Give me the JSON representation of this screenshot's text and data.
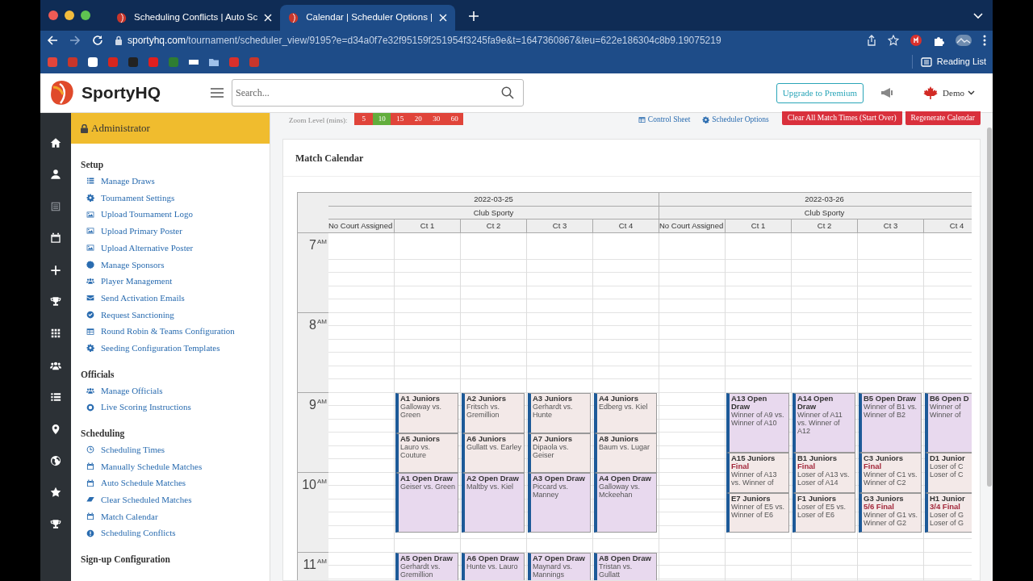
{
  "browser": {
    "tabs": [
      {
        "title": "Scheduling Conflicts | Auto Sc",
        "selected": false
      },
      {
        "title": "Calendar | Scheduler Options |",
        "selected": true
      }
    ],
    "url_domain": "sportyhq.com",
    "url_path": "/tournament/scheduler_view/9195?e=d34a0f7e32f95159f251954f3245fa9e&t=1647360867&teu=622e186304c8b9.19075219",
    "reading_list": "Reading List"
  },
  "header": {
    "brand": "SportyHQ",
    "search_placeholder": "Search...",
    "upgrade_button": "Upgrade to Premium",
    "user": "Demo"
  },
  "sidebar": {
    "role": "Administrator",
    "sections": [
      {
        "title": "Setup",
        "items": [
          "Manage Draws",
          "Tournament Settings",
          "Upload Tournament Logo",
          "Upload Primary Poster",
          "Upload Alternative Poster",
          "Manage Sponsors",
          "Player Management",
          "Send Activation Emails",
          "Request Sanctioning",
          "Round Robin & Teams Configuration",
          "Seeding Configuration Templates"
        ]
      },
      {
        "title": "Officials",
        "items": [
          "Manage Officials",
          "Live Scoring Instructions"
        ]
      },
      {
        "title": "Scheduling",
        "items": [
          "Scheduling Times",
          "Manually Schedule Matches",
          "Auto Schedule Matches",
          "Clear Scheduled Matches",
          "Match Calendar",
          "Scheduling Conflicts"
        ]
      },
      {
        "title": "Sign-up Configuration"
      }
    ]
  },
  "toolbar": {
    "zoom_label": "Zoom Level (mins):",
    "zoom_levels": [
      {
        "label": "5",
        "selected": false
      },
      {
        "label": "10",
        "selected": true
      },
      {
        "label": "15",
        "selected": false
      },
      {
        "label": "20",
        "selected": false
      },
      {
        "label": "30",
        "selected": false
      },
      {
        "label": "60",
        "selected": false
      }
    ],
    "links": [
      "Control Sheet",
      "Scheduler Options"
    ],
    "buttons": [
      "Clear All Match Times (Start Over)",
      "Regenerate Calendar"
    ]
  },
  "calendar": {
    "title": "Match Calendar",
    "hours": [
      {
        "hour": "7",
        "period": "AM"
      },
      {
        "hour": "8",
        "period": "AM"
      },
      {
        "hour": "9",
        "period": "AM"
      },
      {
        "hour": "10",
        "period": "AM"
      },
      {
        "hour": "11",
        "period": "AM"
      }
    ],
    "days": [
      {
        "date": "2022-03-25",
        "venue": "Club Sporty",
        "columns": [
          {
            "name": "No Court Assigned"
          },
          {
            "name": "Ct 1",
            "blocks": [
              [
                {
                  "kind": "juniors",
                  "title": "A1 Juniors",
                  "lines": [
                    "Galloway vs.",
                    "Green"
                  ]
                },
                {
                  "kind": "juniors",
                  "title": "A5 Juniors",
                  "lines": [
                    "Lauro vs.",
                    "Couture"
                  ]
                },
                {
                  "kind": "open",
                  "title": "A1 Open Draw",
                  "lines": [
                    "Geiser vs. Green"
                  ]
                }
              ],
              [
                {
                  "kind": "open",
                  "title": "A5 Open Draw",
                  "lines": [
                    "Gerhardt vs.",
                    "Gremillion"
                  ]
                }
              ]
            ]
          },
          {
            "name": "Ct 2",
            "blocks": [
              [
                {
                  "kind": "juniors",
                  "title": "A2 Juniors",
                  "lines": [
                    "Fritsch vs.",
                    "Gremillion"
                  ]
                },
                {
                  "kind": "juniors",
                  "title": "A6 Juniors",
                  "lines": [
                    "Gullatt vs. Earley"
                  ]
                },
                {
                  "kind": "open",
                  "title": "A2 Open Draw",
                  "lines": [
                    "Maltby vs. Kiel"
                  ]
                }
              ],
              [
                {
                  "kind": "open",
                  "title": "A6 Open Draw",
                  "lines": [
                    "Hunte vs. Lauro"
                  ]
                }
              ]
            ]
          },
          {
            "name": "Ct 3",
            "blocks": [
              [
                {
                  "kind": "juniors",
                  "title": "A3 Juniors",
                  "lines": [
                    "Gerhardt vs.",
                    "Hunte"
                  ]
                },
                {
                  "kind": "juniors",
                  "title": "A7 Juniors",
                  "lines": [
                    "Dipaola vs.",
                    "Geiser"
                  ]
                },
                {
                  "kind": "open",
                  "title": "A3 Open Draw",
                  "lines": [
                    "Piccard vs.",
                    "Manney"
                  ]
                }
              ],
              [
                {
                  "kind": "open",
                  "title": "A7 Open Draw",
                  "lines": [
                    "Maynard vs.",
                    "Mannings"
                  ]
                }
              ]
            ]
          },
          {
            "name": "Ct 4",
            "blocks": [
              [
                {
                  "kind": "juniors",
                  "title": "A4 Juniors",
                  "lines": [
                    "Edberg vs. Kiel"
                  ]
                },
                {
                  "kind": "juniors",
                  "title": "A8 Juniors",
                  "lines": [
                    "Baum vs. Lugar"
                  ]
                },
                {
                  "kind": "open",
                  "title": "A4 Open Draw",
                  "lines": [
                    "Galloway vs.",
                    "Mckeehan"
                  ]
                }
              ],
              [
                {
                  "kind": "open",
                  "title": "A8 Open Draw",
                  "lines": [
                    "Tristan vs. Gullatt"
                  ]
                }
              ]
            ]
          }
        ]
      },
      {
        "date": "2022-03-26",
        "venue": "Club Sporty",
        "columns": [
          {
            "name": "No Court Assigned"
          },
          {
            "name": "Ct 1",
            "blocks": [
              [
                {
                  "kind": "open",
                  "title": "A13 Open Draw",
                  "lines": [
                    "Winner of A9 vs.",
                    "Winner of A10"
                  ]
                },
                {
                  "kind": "juniors",
                  "title": "A15 Juniors",
                  "final": "Final",
                  "lines": [
                    "Winner of A13",
                    "vs. Winner of"
                  ]
                },
                {
                  "kind": "juniors",
                  "title": "E7 Juniors",
                  "lines": [
                    "Winner of E5 vs.",
                    "Winner of E6"
                  ]
                }
              ]
            ]
          },
          {
            "name": "Ct 2",
            "blocks": [
              [
                {
                  "kind": "open",
                  "title": "A14 Open Draw",
                  "lines": [
                    "Winner of A11",
                    "vs. Winner of",
                    "A12"
                  ]
                },
                {
                  "kind": "juniors",
                  "title": "B1 Juniors",
                  "final": "Final",
                  "lines": [
                    "Loser of A13 vs.",
                    "Loser of A14"
                  ]
                },
                {
                  "kind": "juniors",
                  "title": "F1 Juniors",
                  "lines": [
                    "Loser of E5 vs.",
                    "Loser of E6"
                  ]
                }
              ]
            ]
          },
          {
            "name": "Ct 3",
            "blocks": [
              [
                {
                  "kind": "open",
                  "title": "B5 Open Draw",
                  "lines": [
                    "Winner of B1 vs.",
                    "Winner of B2"
                  ]
                },
                {
                  "kind": "juniors",
                  "title": "C3 Juniors",
                  "final": "Final",
                  "lines": [
                    "Winner of C1 vs.",
                    "Winner of C2"
                  ]
                },
                {
                  "kind": "juniors",
                  "title": "G3 Juniors",
                  "final": "5/6 Final",
                  "lines": [
                    "Winner of G1 vs.",
                    "Winner of G2"
                  ]
                }
              ]
            ]
          },
          {
            "name": "Ct 4",
            "blocks": [
              [
                {
                  "kind": "open",
                  "title": "B6 Open D",
                  "lines": [
                    "Winner of",
                    "Winner of"
                  ]
                },
                {
                  "kind": "juniors",
                  "title": "D1 Junior",
                  "lines": [
                    "Loser of C",
                    "Loser of C"
                  ]
                },
                {
                  "kind": "juniors",
                  "title": "H1 Junior",
                  "final": "3/4 Final",
                  "lines": [
                    "Loser of G",
                    "Loser of G"
                  ]
                }
              ]
            ]
          }
        ]
      }
    ]
  }
}
